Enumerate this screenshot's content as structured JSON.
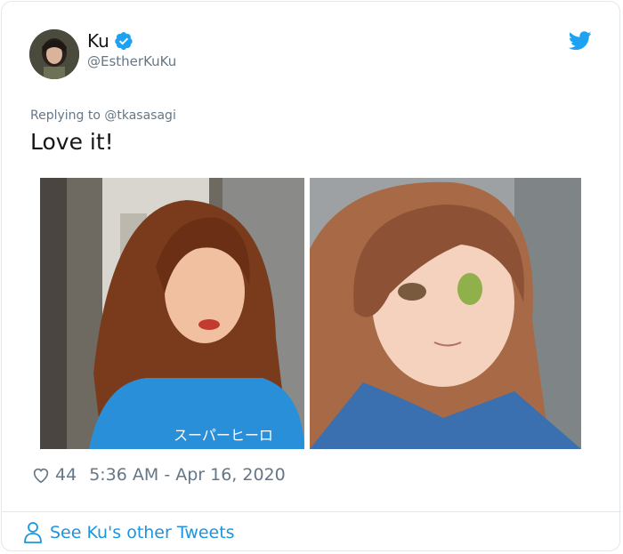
{
  "author": {
    "name": "Ku",
    "handle": "@EstherKuKu"
  },
  "reply": {
    "text": "Replying to @tkasasagi"
  },
  "tweet": {
    "text": "Love it!"
  },
  "media": {
    "sign_text": "スーパーヒーロ"
  },
  "meta": {
    "likes": "44",
    "timestamp": "5:36 AM - Apr 16, 2020"
  },
  "footer": {
    "see_other": "See Ku's other Tweets"
  },
  "colors": {
    "accent": "#1b95e0",
    "muted": "#657786",
    "text": "#14171a"
  },
  "icons": [
    "verified-badge-icon",
    "twitter-bird-icon",
    "heart-icon",
    "person-icon"
  ]
}
